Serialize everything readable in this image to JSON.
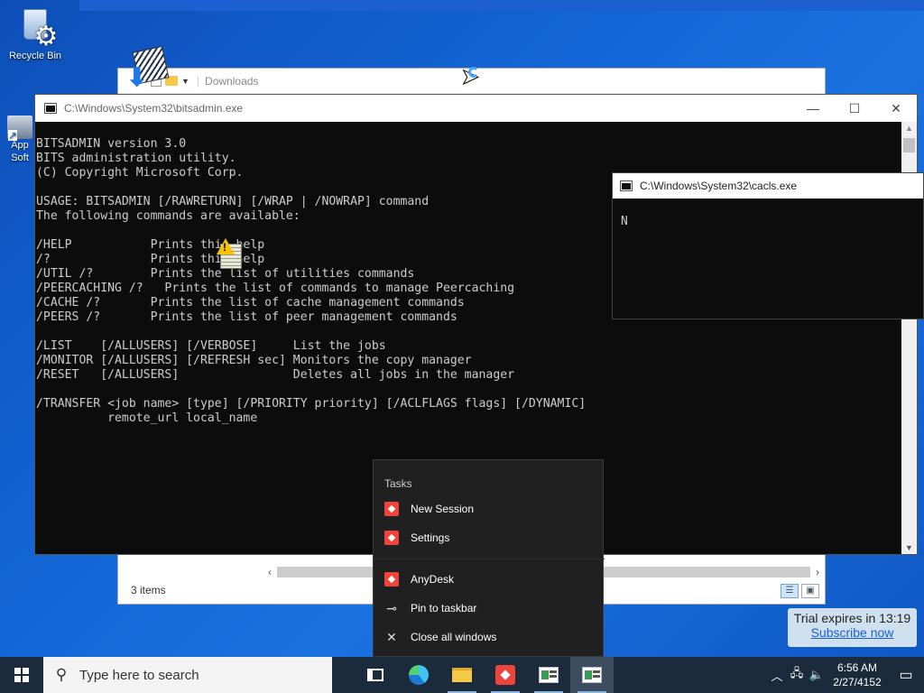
{
  "desktop": {
    "recycle_label": "Recycle Bin",
    "apps_label": "App Soft"
  },
  "explorer": {
    "address": "Downloads",
    "status": "3 items"
  },
  "console": {
    "title": "C:\\Windows\\System32\\bitsadmin.exe",
    "minimize": "—",
    "maximize": "☐",
    "close": "✕",
    "output": "BITSADMIN version 3.0\nBITS administration utility.\n(C) Copyright Microsoft Corp.\n\nUSAGE: BITSADMIN [/RAWRETURN] [/WRAP | /NOWRAP] command\nThe following commands are available:\n\n/HELP           Prints this help\n/?              Prints this help\n/UTIL /?        Prints the list of utilities commands\n/PEERCACHING /?   Prints the list of commands to manage Peercaching\n/CACHE /?       Prints the list of cache management commands\n/PEERS /?       Prints the list of peer management commands\n\n/LIST    [/ALLUSERS] [/VERBOSE]     List the jobs\n/MONITOR [/ALLUSERS] [/REFRESH sec] Monitors the copy manager\n/RESET   [/ALLUSERS]                Deletes all jobs in the manager\n\n/TRANSFER <job name> [type] [/PRIORITY priority] [/ACLFLAGS flags] [/DYNAMIC]\n          remote_url local_name"
  },
  "cacls": {
    "title": "C:\\Windows\\System32\\cacls.exe",
    "output": "N"
  },
  "jumplist": {
    "header": "Tasks",
    "items": [
      {
        "label": "New Session",
        "icon": "anydesk-icon"
      },
      {
        "label": "Settings",
        "icon": "anydesk-icon"
      },
      {
        "label": "AnyDesk",
        "icon": "anydesk-icon"
      },
      {
        "label": "Pin to taskbar",
        "icon": "pin-icon"
      },
      {
        "label": "Close all windows",
        "icon": "close-icon"
      }
    ]
  },
  "trial": {
    "expires": "Trial expires in 13:19",
    "subscribe": "Subscribe now"
  },
  "taskbar": {
    "search_placeholder": "Type here to search",
    "time": "6:56 AM",
    "date": "2/27/4152"
  },
  "colors": {
    "console_bg": "#0c0c0c",
    "console_text": "#cccccc",
    "anydesk_red": "#ef443b",
    "taskbar_bg": "#1b2b3c"
  }
}
